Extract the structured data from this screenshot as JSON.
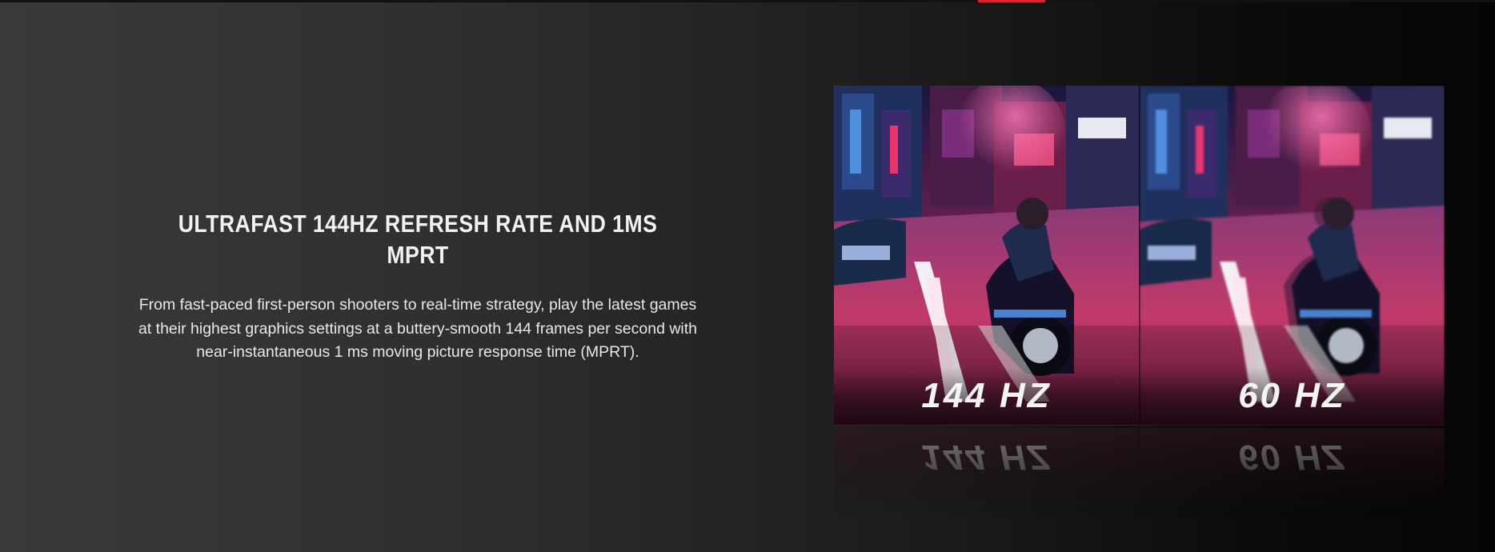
{
  "feature": {
    "title": "ULTRAFAST 144HZ REFRESH RATE AND 1MS MPRT",
    "description": "From fast-paced first-person shooters to real-time strategy, play the latest games at their highest graphics settings at a buttery-smooth 144 frames per second with near-instantaneous 1 ms moving picture response time (MPRT)."
  },
  "comparison": {
    "left_label": "144 HZ",
    "right_label": "60 HZ"
  },
  "colors": {
    "accent": "#d9262e",
    "neon_pink": "#e8356e",
    "neon_blue": "#4f8fe0",
    "background_left": "#3a3a3a",
    "background_right": "#050505"
  }
}
